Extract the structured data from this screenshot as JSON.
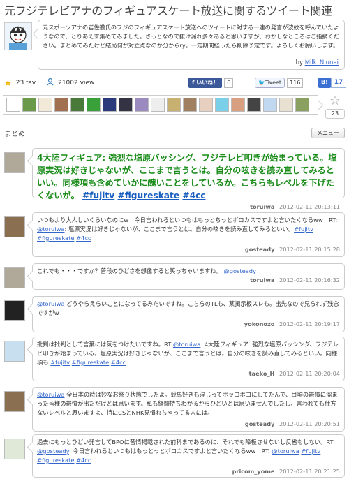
{
  "page": {
    "title": "元フジテレビアナのフィギュアスケート放送に関するツイート関連",
    "description": "元スポーツアナの岩佐徹氏のフジのフィギュアスケート放送へのツイートに対する一連の発言が波紋を呼んでいたようなので、とりあえず集めてみました。ざっとなので抜け漏れ多々あると思いますが、おかしなところはご指摘ください。まとめてみたけど結局何が対立点なのか分からry。一定期間経ったら削除予定です。よろしくお願いします。",
    "by_label": "by",
    "author": "Milk_Niunai"
  },
  "stats": {
    "fav": "23 fav",
    "view": "21002 view"
  },
  "share": {
    "like_label": "いいね！",
    "like_count": "6",
    "tweet_label": "Tweet",
    "tweet_count": "116",
    "hatena_label": "B!",
    "hatena_count": "17"
  },
  "favorites": {
    "count": "23"
  },
  "section": {
    "title": "まとめ",
    "menu_label": "メニュー"
  },
  "tweets": [
    {
      "segments": [
        {
          "t": "4大陸フィギュア: 強烈な塩原バッシング、フジテレビ叩きが始まっている。塩原実況は好きじゃないが、ここまで言うとは。自分の呟きを読み直してみるといい。同様項も含めていかに醜いことをしているか。こちらもレベルを下げたくないが。 ",
          "l": false
        },
        {
          "t": "#fujitv",
          "l": true
        },
        {
          "t": " ",
          "l": false
        },
        {
          "t": "#figureskate",
          "l": true
        },
        {
          "t": " ",
          "l": false
        },
        {
          "t": "#4cc",
          "l": true
        }
      ],
      "user": "toruiwa",
      "time": "2012-02-11 20:13:11"
    },
    {
      "segments": [
        {
          "t": "いつもより大人しいくらいなのにw　今日言われるといつもはもっとちっとボロカスですよと言いたくなるww　RT: ",
          "l": false
        },
        {
          "t": "@toruiwa",
          "l": true
        },
        {
          "t": ": 塩原実況は好きじゃないが、ここまで言うとは。自分の呟きを読み直してみるといい。",
          "l": false
        },
        {
          "t": "#fujitv",
          "l": true
        },
        {
          "t": " ",
          "l": false
        },
        {
          "t": "#figureskate",
          "l": true
        },
        {
          "t": " ",
          "l": false
        },
        {
          "t": "#4cc",
          "l": true
        }
      ],
      "user": "gosteady",
      "time": "2012-02-11 20:15:28"
    },
    {
      "segments": [
        {
          "t": "これでも・・・ですか？普段のひどさを想像すると笑っちゃいますね。 ",
          "l": false
        },
        {
          "t": "@gosteady",
          "l": true
        }
      ],
      "user": "toruiwa",
      "time": "2012-02-11 20:16:32"
    },
    {
      "segments": [
        {
          "t": "@toruiwa",
          "l": true
        },
        {
          "t": " どうやらえらいことになってるみたいですね。こちらのTLも、某掲示板スレも。出先なので見られず残念ですがw",
          "l": false
        }
      ],
      "user": "yokonozo",
      "time": "2012-02-11 20:19:17"
    },
    {
      "segments": [
        {
          "t": "批判は批判として言葉には気をつけたいですね。RT ",
          "l": false
        },
        {
          "t": "@toruiwa",
          "l": true
        },
        {
          "t": ": 4大陸フィギュア: 強烈な塩原バッシング、フジテレビ叩きが始まっている。塩原実況は好きじゃないが、ここまで言うとは。自分の呟きを読み直してみるといい。同様項も ",
          "l": false
        },
        {
          "t": "#fujitv",
          "l": true
        },
        {
          "t": " ",
          "l": false
        },
        {
          "t": "#figureskate",
          "l": true
        },
        {
          "t": " ",
          "l": false
        },
        {
          "t": "#4cc",
          "l": true
        }
      ],
      "user": "taeko_H",
      "time": "2012-02-11 20:20:04"
    },
    {
      "segments": [
        {
          "t": "@toruiwa",
          "l": true
        },
        {
          "t": " 全日本の時は妙なお祭り状態でしたよ。競馬好きも混じってボッコボコにしてたんで、目頃の鬱憤に溜まった皆様の鬱憤が出ただけとは思います。私も経験持ちわかるからひどいとは思いませんでしたし、言われても仕方ないレベルと思いますよ、特にCSとNHK見慣れちゃってる人には。",
          "l": false
        }
      ],
      "user": "gosteady",
      "time": "2012-02-11 20:20:51"
    },
    {
      "segments": [
        {
          "t": "過去にもっとひどい発言してBPOに苦情掲載された前科まであるのに、それでも降板させないし反省もしない。RT ",
          "l": false
        },
        {
          "t": "@gosteady",
          "l": true
        },
        {
          "t": ": 今日言われるといつもはもっとっとボロカスですよと言いたくなるww　RT: ",
          "l": false
        },
        {
          "t": "@toruiwa",
          "l": true
        },
        {
          "t": " ",
          "l": false
        },
        {
          "t": "#fujitv",
          "l": true
        },
        {
          "t": " ",
          "l": false
        },
        {
          "t": "#figureskate",
          "l": true
        },
        {
          "t": " ",
          "l": false
        },
        {
          "t": "#4cc",
          "l": true
        }
      ],
      "user": "pricom_yome",
      "time": "2012-02-11 20:21:25"
    }
  ]
}
